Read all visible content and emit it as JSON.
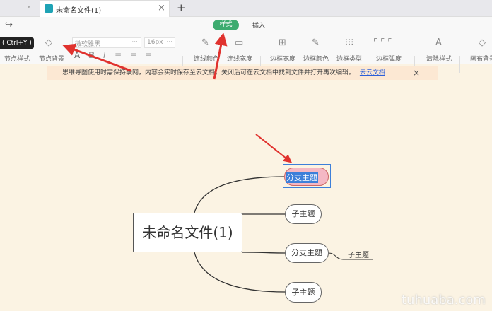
{
  "tabs": {
    "inactive_dot": "•",
    "active_title": "未命名文件(1)",
    "new_tab": "+",
    "close": "×"
  },
  "toolbar": {
    "redo_icon": "↪",
    "tooltip": "( Ctrl+Y )",
    "mode_tabs": [
      "样式",
      "插入"
    ],
    "font_family": "微软雅黑",
    "font_size": "16px",
    "more": "···",
    "items": [
      "节点样式",
      "节点背景",
      "连线颜色",
      "连线宽度",
      "边框宽度",
      "边框颜色",
      "边框类型",
      "边框弧度",
      "清除样式",
      "画布背景"
    ]
  },
  "notice": {
    "text": "思维导图使用时需保持联网，内容会实时保存至云文档。关闭后可在云文档中找到文件并打开再次编辑。",
    "link": "去云文档",
    "close": "×"
  },
  "mindmap": {
    "root": "未命名文件(1)",
    "branch_selected": "分支主题",
    "child1": "子主题",
    "branch2": "分支主题",
    "branch2_child": "子主题",
    "child3": "子主题"
  },
  "watermark": "tuhuaba.com",
  "colors": {
    "accent": "#3dab6f",
    "arrow": "#e0322e",
    "selected_fill": "#f4b8c4",
    "selection": "#3d7fd9"
  }
}
